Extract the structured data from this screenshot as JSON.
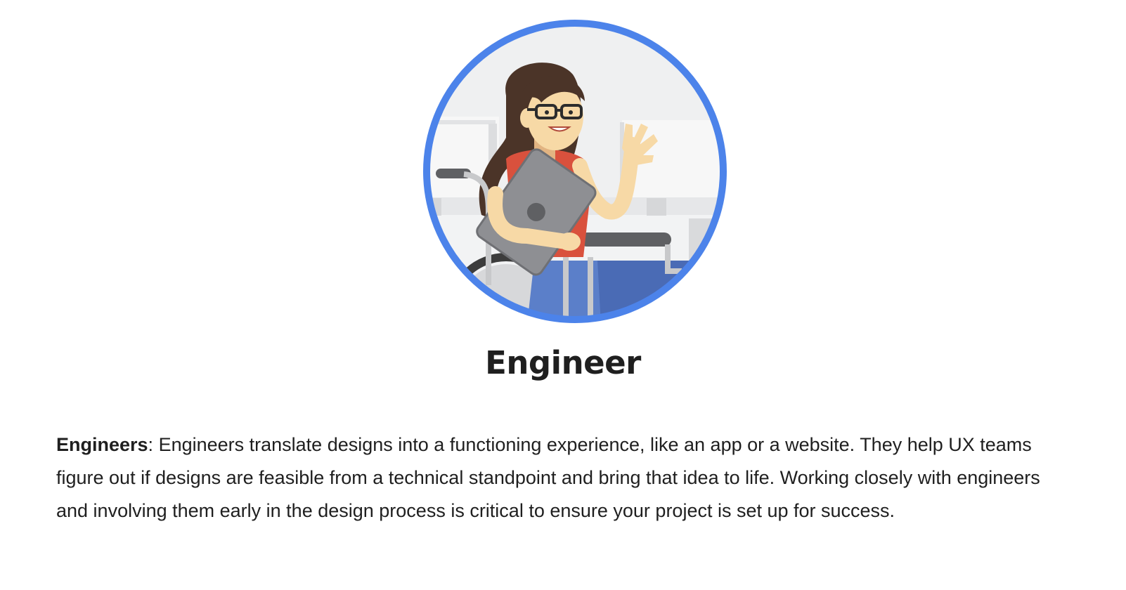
{
  "role": {
    "title": "Engineer",
    "illustration_icon": "engineer-in-wheelchair-illustration",
    "ring_color": "#4c83ea"
  },
  "description": {
    "term": "Engineers",
    "separator": ":",
    "text": " Engineers translate designs into a functioning experience, like an app or a website. They help UX teams figure out if designs are feasible from a technical standpoint and bring that idea to life. Working closely with engineers and involving them early in the design process is critical to ensure your project is set up for success."
  }
}
